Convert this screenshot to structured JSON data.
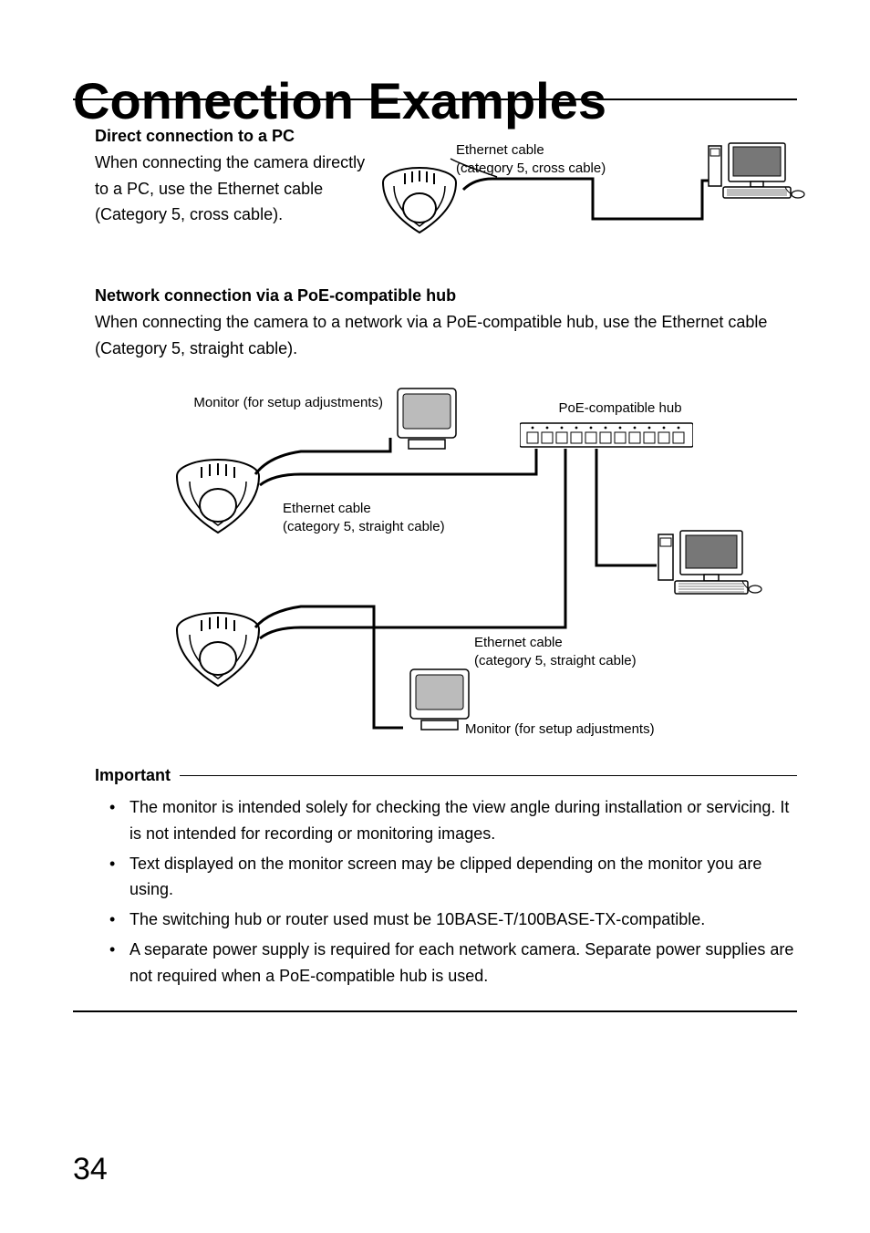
{
  "title": "Connection Examples",
  "section1": {
    "heading": "Direct connection to a PC",
    "body": "When connecting the camera directly to a PC, use the Ethernet cable (Category 5, cross cable).",
    "cable_label_l1": "Ethernet cable",
    "cable_label_l2": "(category 5, cross cable)"
  },
  "section2": {
    "heading": "Network connection via a PoE-compatible hub",
    "body": "When connecting the camera to a network via a PoE-compatible hub, use the Ethernet cable (Category 5, straight cable).",
    "monitor_label": "Monitor (for setup adjustments)",
    "hub_label": "PoE-compatible hub",
    "cable_label_a_l1": "Ethernet cable",
    "cable_label_a_l2": "(category 5, straight cable)",
    "cable_label_b_l1": "Ethernet cable",
    "cable_label_b_l2": "(category 5, straight cable)",
    "monitor_label_2": "Monitor (for setup adjustments)"
  },
  "important": {
    "heading": "Important",
    "items": [
      "The monitor is intended solely for checking the view angle during installation or servicing. It is not intended for recording or monitoring images.",
      "Text displayed on the monitor screen may be clipped depending on the monitor you are using.",
      "The switching hub or router used must be 10BASE-T/100BASE-TX-compatible.",
      "A separate power supply is required for each network camera. Separate power supplies are not required when a PoE-compatible hub is used."
    ]
  },
  "page_number": "34"
}
